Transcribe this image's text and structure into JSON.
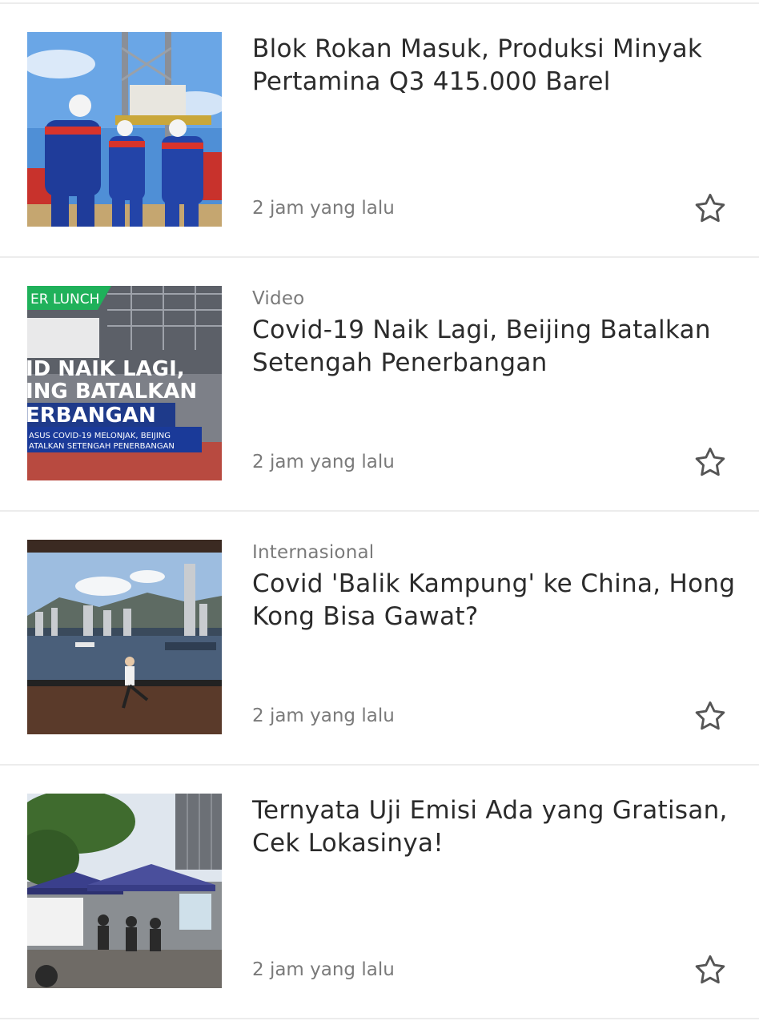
{
  "articles": [
    {
      "category": "",
      "title": "Blok Rokan Masuk, Produksi Minyak Pertamina Q3 415.000 Barel",
      "time": "2 jam yang lalu",
      "thumbnail": "oil-rig-workers-photo"
    },
    {
      "category": "Video",
      "title": "Covid-19 Naik Lagi, Beijing Batalkan Setengah Penerbangan",
      "time": "2 jam yang lalu",
      "thumbnail": "video-thumbnail",
      "thumb_text": {
        "banner": "ER LUNCH",
        "line1": "ID NAIK LAGI,",
        "line2": "ING BATALKAN",
        "line3": "ERBANGAN",
        "sub1": "ASUS COVID-19 MELONJAK, BEIJING",
        "sub2": "ATALKAN SETENGAH PENERBANGAN"
      }
    },
    {
      "category": "Internasional",
      "title": "Covid 'Balik Kampung' ke China, Hong Kong Bisa Gawat?",
      "time": "2 jam yang lalu",
      "thumbnail": "hong-kong-harbour-photo"
    },
    {
      "category": "",
      "title": "Ternyata Uji Emisi Ada yang Gratisan, Cek Lokasinya!",
      "time": "2 jam yang lalu",
      "thumbnail": "emission-test-tents-photo"
    }
  ],
  "colors": {
    "text": "#2b2b2b",
    "muted": "#7a7a7a",
    "divider": "#ececec",
    "video_green": "#1fb15a"
  },
  "icons": {
    "bookmark": "star-outline-icon"
  }
}
